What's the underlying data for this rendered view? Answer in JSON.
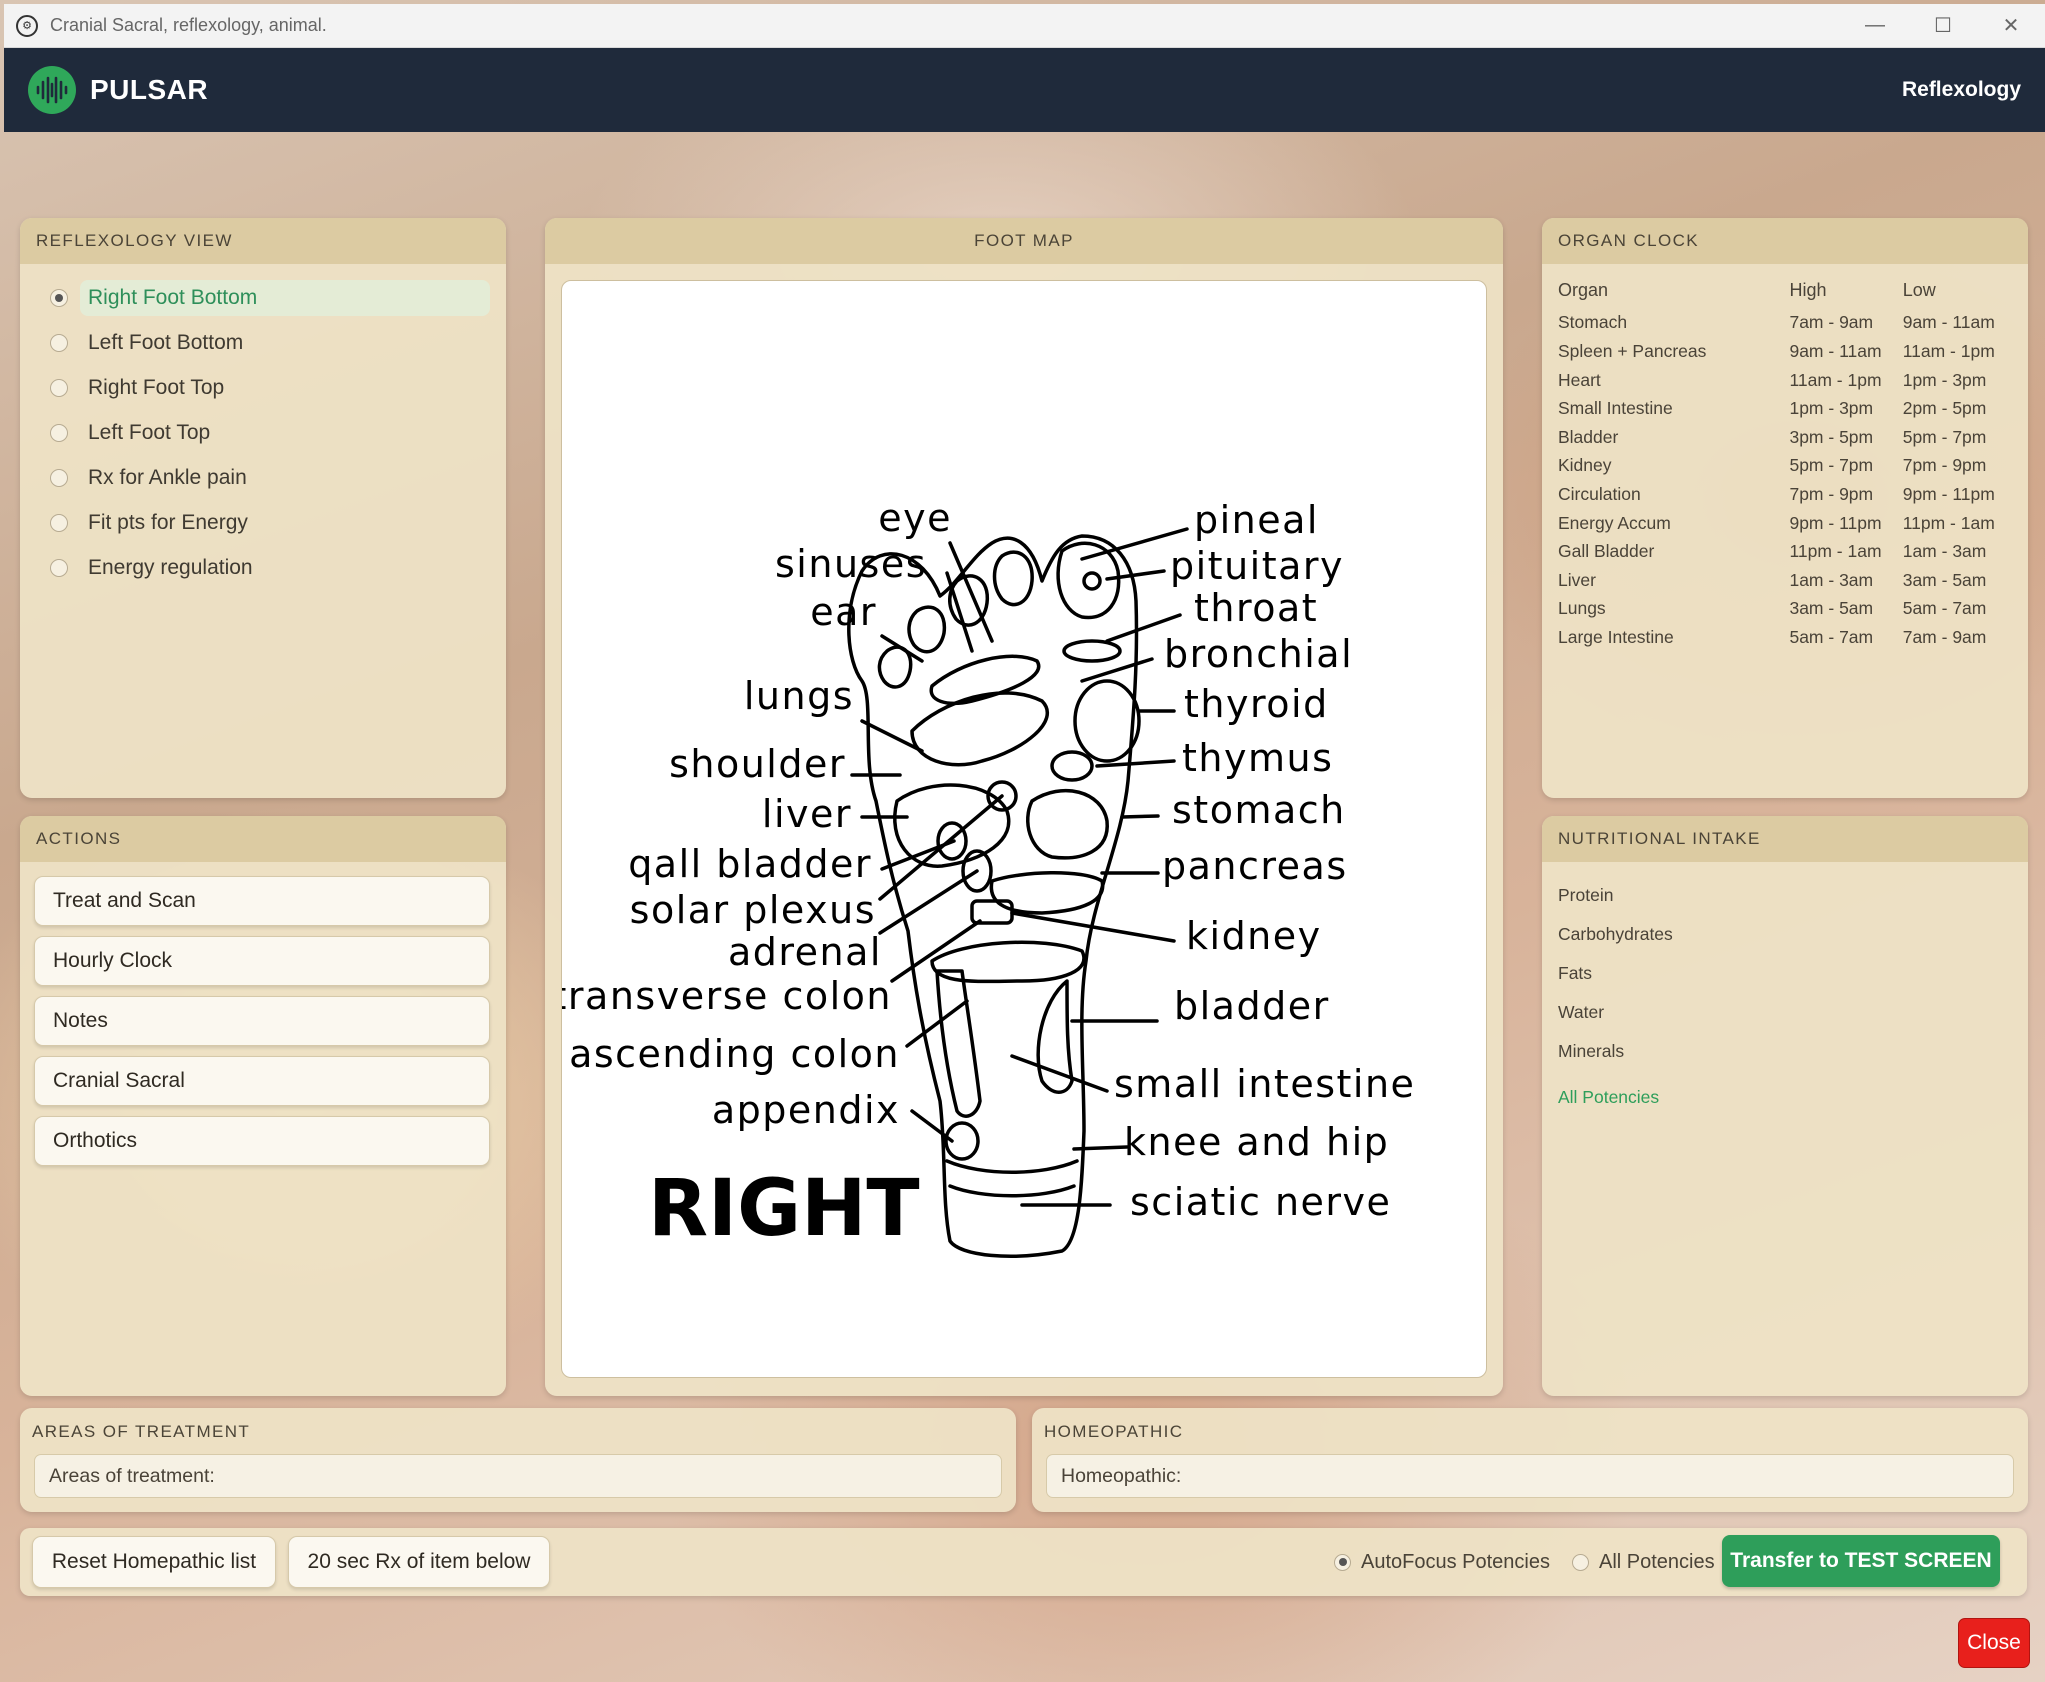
{
  "window": {
    "title": "Cranial Sacral, reflexology, animal.",
    "controls": [
      "—",
      "☐",
      "✕"
    ]
  },
  "header": {
    "brand": "PULSAR",
    "section": "Reflexology"
  },
  "reflexology_view": {
    "title": "REFLEXOLOGY VIEW",
    "selected": "Right Foot Bottom",
    "options": [
      "Right Foot Bottom",
      "Left Foot Bottom",
      "Right Foot Top",
      "Left Foot Top",
      "Rx for Ankle pain",
      "Fit pts for Energy",
      "Energy regulation"
    ]
  },
  "actions": {
    "title": "ACTIONS",
    "buttons": [
      "Treat and Scan",
      "Hourly Clock",
      "Notes",
      "Cranial Sacral",
      "Orthotics"
    ]
  },
  "foot_map": {
    "title": "FOOT MAP",
    "side_label": "RIGHT",
    "left_labels": [
      "eye",
      "sinuses",
      "ear",
      "lungs",
      "shoulder",
      "liver",
      "qall bladder",
      "solar plexus",
      "adrenal",
      "transverse colon",
      "ascending colon",
      "appendix"
    ],
    "right_labels": [
      "pineal",
      "pituitary",
      "throat",
      "bronchial",
      "thyroid",
      "thymus",
      "stomach",
      "pancreas",
      "kidney",
      "bladder",
      "small intestine",
      "knee and hip",
      "sciatic nerve"
    ]
  },
  "organ_clock": {
    "title": "ORGAN CLOCK",
    "headers": [
      "Organ",
      "High",
      "Low"
    ],
    "rows": [
      [
        "Stomach",
        "7am - 9am",
        "9am - 11am"
      ],
      [
        "Spleen + Pancreas",
        "9am - 11am",
        "11am - 1pm"
      ],
      [
        "Heart",
        "11am - 1pm",
        "1pm - 3pm"
      ],
      [
        "Small Intestine",
        "1pm - 3pm",
        "2pm - 5pm"
      ],
      [
        "Bladder",
        "3pm - 5pm",
        "5pm - 7pm"
      ],
      [
        "Kidney",
        "5pm - 7pm",
        "7pm - 9pm"
      ],
      [
        "Circulation",
        "7pm - 9pm",
        "9pm - 11pm"
      ],
      [
        "Energy Accum",
        "9pm - 11pm",
        "11pm - 1am"
      ],
      [
        "Gall Bladder",
        "11pm - 1am",
        "1am - 3am"
      ],
      [
        "Liver",
        "1am - 3am",
        "3am - 5am"
      ],
      [
        "Lungs",
        "3am - 5am",
        "5am - 7am"
      ],
      [
        "Large Intestine",
        "5am - 7am",
        "7am - 9am"
      ]
    ]
  },
  "nutritional_intake": {
    "title": "NUTRITIONAL INTAKE",
    "items": [
      "Protein",
      "Carbohydrates",
      "Fats",
      "Water",
      "Minerals"
    ],
    "link": "All Potencies"
  },
  "areas_of_treatment": {
    "title": "AREAS OF TREATMENT",
    "placeholder": "Areas of treatment:"
  },
  "homeopathic": {
    "title": "HOMEOPATHIC",
    "placeholder": "Homeopathic:"
  },
  "toolbar": {
    "reset_label": "Reset Homepathic list",
    "rx_label": "20 sec Rx of item below",
    "autofocus_label": "AutoFocus Potencies",
    "all_potencies_label": "All Potencies",
    "transfer_label": "Transfer to TEST SCREEN",
    "close_label": "Close"
  },
  "colors": {
    "header_bg": "#1f2a3b",
    "accent_green": "#2e9e5a",
    "panel_bg": "#eee2c6",
    "panel_head": "#dccba2",
    "close_red": "#e8201c"
  }
}
